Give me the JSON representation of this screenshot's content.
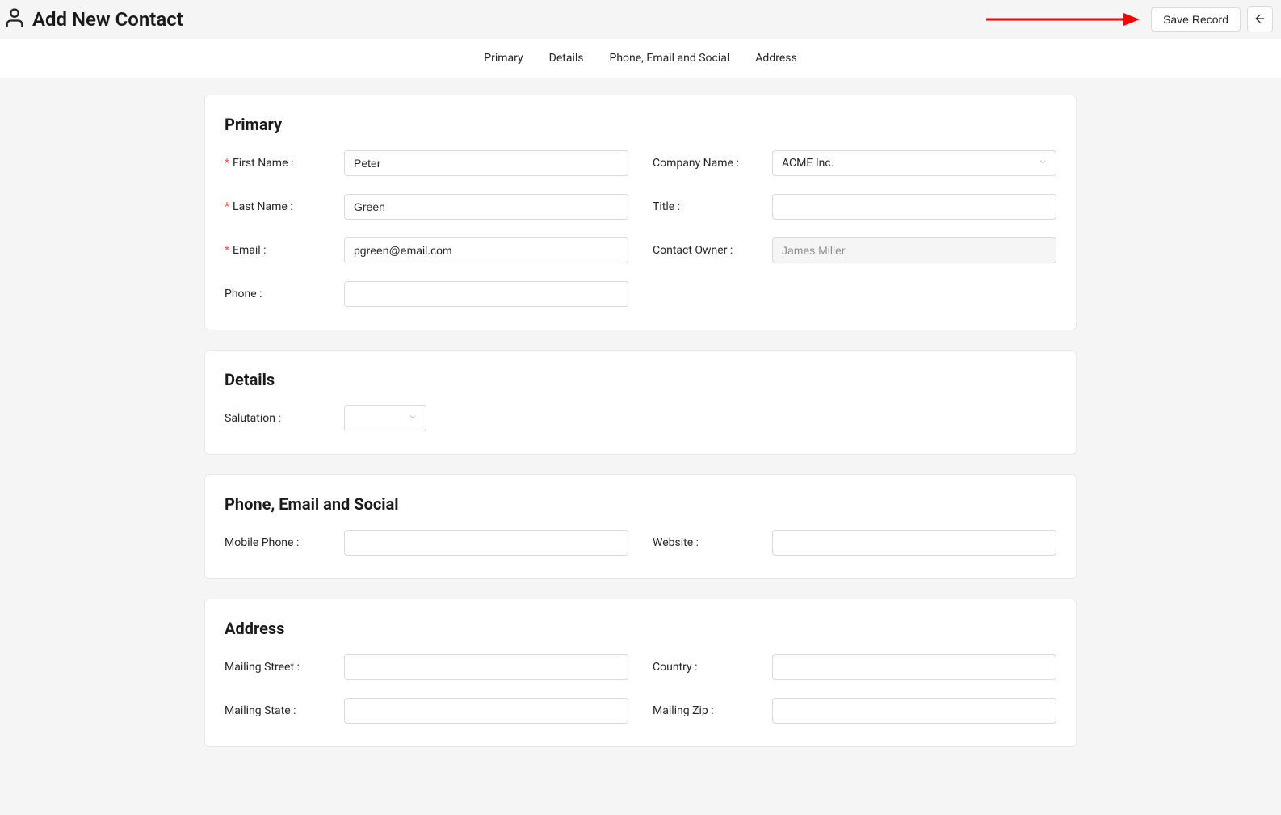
{
  "header": {
    "title": "Add New Contact",
    "save_label": "Save Record"
  },
  "tabs": {
    "primary": "Primary",
    "details": "Details",
    "phone_email_social": "Phone, Email and Social",
    "address": "Address"
  },
  "sections": {
    "primary": {
      "title": "Primary",
      "first_name_label": "First Name :",
      "first_name_value": "Peter",
      "last_name_label": "Last Name :",
      "last_name_value": "Green",
      "email_label": "Email :",
      "email_value": "pgreen@email.com",
      "phone_label": "Phone :",
      "phone_value": "",
      "company_label": "Company Name :",
      "company_value": "ACME Inc.",
      "title_label": "Title :",
      "title_value": "",
      "owner_label": "Contact Owner :",
      "owner_value": "James Miller"
    },
    "details": {
      "title": "Details",
      "salutation_label": "Salutation :",
      "salutation_value": ""
    },
    "social": {
      "title": "Phone, Email and Social",
      "mobile_label": "Mobile Phone :",
      "mobile_value": "",
      "website_label": "Website :",
      "website_value": ""
    },
    "address": {
      "title": "Address",
      "street_label": "Mailing Street :",
      "street_value": "",
      "country_label": "Country :",
      "country_value": "",
      "state_label": "Mailing State :",
      "state_value": "",
      "zip_label": "Mailing Zip :",
      "zip_value": ""
    }
  }
}
